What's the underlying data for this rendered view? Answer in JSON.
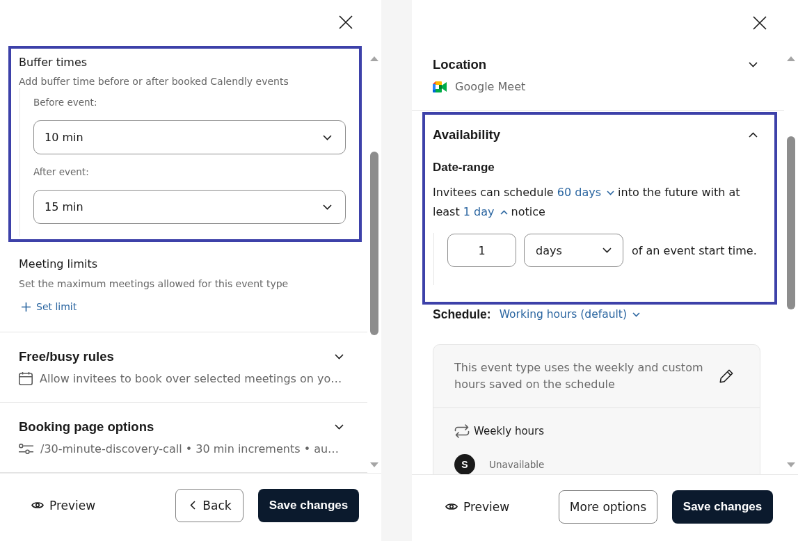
{
  "panels": [
    {
      "sections": [
        {
          "kind": "buffer",
          "highlighted": true,
          "title": "Buffer times",
          "subtitle": "Add buffer time before or after booked Calendly events",
          "fields": [
            {
              "label": "Before event:",
              "value": "10 min"
            },
            {
              "label": "After event:",
              "value": "15 min"
            }
          ]
        },
        {
          "kind": "limits",
          "title": "Meeting limits",
          "subtitle": "Set the maximum meetings allowed for this event type",
          "action": "Set limit"
        },
        {
          "kind": "freebusy",
          "title": "Free/busy rules",
          "expanded": false,
          "summary": "Allow invitees to book over selected meetings on yo…"
        },
        {
          "kind": "booking",
          "title": "Booking page options",
          "expanded": false,
          "summary": "/30-minute-discovery-call • 30 min increments • au…"
        }
      ],
      "footer": {
        "preview": "Preview",
        "buttons": [
          {
            "kind": "back",
            "label": "Back"
          },
          {
            "kind": "primary",
            "label": "Save changes"
          }
        ]
      }
    },
    {
      "sections": [
        {
          "kind": "location",
          "title": "Location",
          "expanded": false,
          "summary": "Google Meet"
        },
        {
          "kind": "availability",
          "highlighted": true,
          "title": "Availability",
          "expanded": true,
          "subheading": "Date-range",
          "sentence": [
            {
              "kind": "text",
              "text": "Invitees can schedule"
            },
            {
              "kind": "dropdown",
              "text": "60 days",
              "expanded": false
            },
            {
              "kind": "text",
              "text": "into the future with at least"
            },
            {
              "kind": "dropdown",
              "text": "1 day",
              "expanded": true
            },
            {
              "kind": "text",
              "text": "notice"
            }
          ],
          "notice": {
            "amount": "1",
            "unit": "days",
            "suffix": "of an event start time."
          }
        },
        {
          "kind": "schedule",
          "label": "Schedule:",
          "value": "Working hours (default)",
          "expanded": false,
          "note": "This event type uses the weekly and custom hours saved on the schedule",
          "heading": "Weekly hours",
          "days": [
            {
              "initial": "S",
              "status": "Unavailable"
            }
          ]
        }
      ],
      "footer": {
        "preview": "Preview",
        "buttons": [
          {
            "kind": "secondary",
            "label": "More options"
          },
          {
            "kind": "primary",
            "label": "Save changes"
          }
        ]
      }
    }
  ]
}
